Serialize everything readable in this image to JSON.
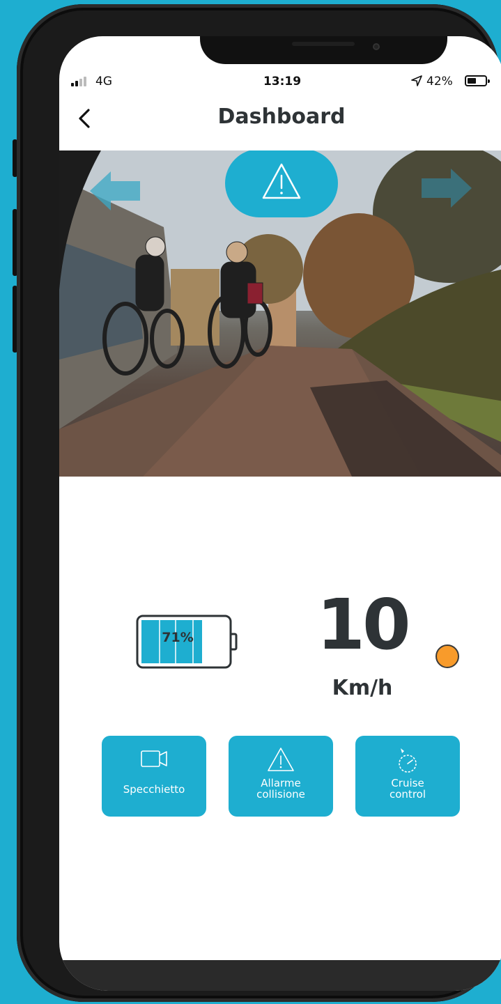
{
  "status_bar": {
    "carrier": "4G",
    "time": "13:19",
    "battery_percent": "42%",
    "battery_level": 0.42,
    "signal_bars_active": 2
  },
  "nav": {
    "title": "Dashboard"
  },
  "camera": {
    "alert_icon": "warning-triangle-icon",
    "left_indicator_icon": "arrow-left-icon",
    "right_indicator_icon": "arrow-right-icon"
  },
  "dashboard": {
    "battery_label": "71%",
    "battery_level": 0.71,
    "speed": "10",
    "speed_unit": "Km/h",
    "status_dot_color": "#f89b2b"
  },
  "actions": [
    {
      "label": "Specchietto",
      "icon": "video-camera-icon"
    },
    {
      "label": "Allarme collisione",
      "icon": "warning-triangle-icon"
    },
    {
      "label": "Cruise control",
      "icon": "speedometer-icon"
    }
  ],
  "colors": {
    "accent": "#1eaed0",
    "text": "#2e3336",
    "status_dot": "#f89b2b"
  }
}
